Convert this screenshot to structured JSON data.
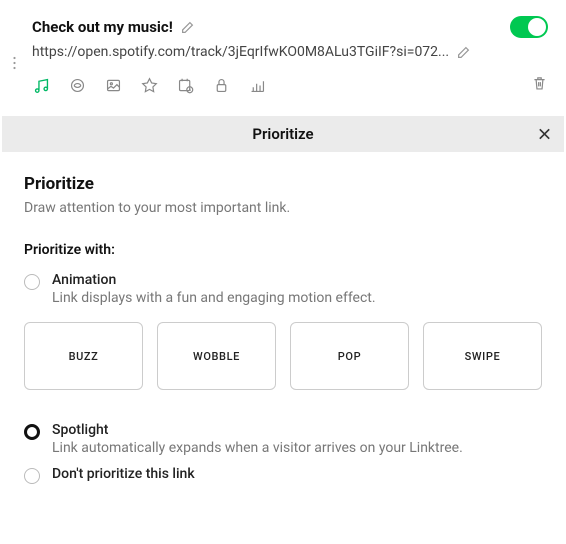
{
  "link": {
    "title": "Check out my music!",
    "url": "https://open.spotify.com/track/3jEqrIfwKO0M8ALu3TGiIF?si=072...",
    "enabled": true
  },
  "iconRow": {
    "items": [
      {
        "name": "music",
        "active": true
      },
      {
        "name": "redirect",
        "active": false
      },
      {
        "name": "thumbnail",
        "active": false
      },
      {
        "name": "star",
        "active": false
      },
      {
        "name": "schedule",
        "active": false
      },
      {
        "name": "lock",
        "active": false
      },
      {
        "name": "analytics",
        "active": false
      }
    ]
  },
  "banner": {
    "title": "Prioritize"
  },
  "panel": {
    "title": "Prioritize",
    "subtitle": "Draw attention to your most important link.",
    "sectionLabel": "Prioritize with:",
    "options": [
      {
        "id": "animation",
        "title": "Animation",
        "desc": "Link displays with a fun and engaging motion effect.",
        "selected": false
      },
      {
        "id": "spotlight",
        "title": "Spotlight",
        "desc": "Link automatically expands when a visitor arrives on your Linktree.",
        "selected": true
      },
      {
        "id": "none",
        "title": "Don't prioritize this link",
        "desc": "",
        "selected": false
      }
    ],
    "animations": [
      "BUZZ",
      "WOBBLE",
      "POP",
      "SWIPE"
    ]
  }
}
